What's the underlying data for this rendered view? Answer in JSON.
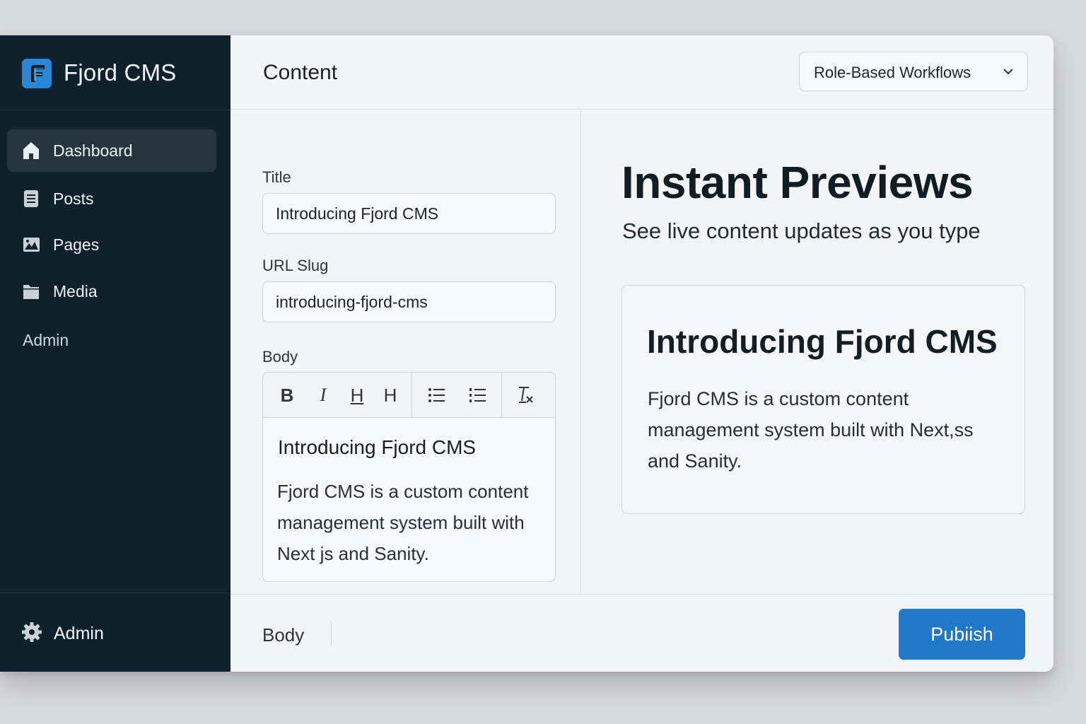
{
  "colors": {
    "sidebar_bg": "#0f212b",
    "accent": "#1f78c9",
    "page_bg": "#f3f4f5"
  },
  "sidebar": {
    "brand": "Fjord CMS",
    "items": [
      {
        "label": "Dashboard",
        "icon": "home-icon",
        "active": true
      },
      {
        "label": "Posts",
        "icon": "document-icon",
        "active": false
      },
      {
        "label": "Pages",
        "icon": "image-icon",
        "active": false
      },
      {
        "label": "Media",
        "icon": "folder-icon",
        "active": false
      }
    ],
    "section_label": "Admin",
    "footer_label": "Admin",
    "footer_icon": "gear-icon"
  },
  "header": {
    "title": "Content",
    "dropdown_value": "Role-Based Workflows"
  },
  "form": {
    "title_label": "Title",
    "title_value": "Introducing Fjord CMS",
    "slug_label": "URL Slug",
    "slug_value": "introducing-fjord-cms",
    "body_label": "Body",
    "toolbar": [
      "B",
      "I",
      "H",
      "H",
      "bulleted-list",
      "numbered-list",
      "clear-format"
    ],
    "editor_heading": "Introducing Fjord CMS",
    "editor_body": "Fjord CMS is a custom content management system built with Next js and Sanity."
  },
  "preview": {
    "title": "Instant Previews",
    "subtitle": "See live content updates as you type",
    "card_title": "Introducing Fjord CMS",
    "card_body": "Fjord CMS is a custom content management system built with Next,ss and Sanity."
  },
  "footer": {
    "label": "Body",
    "publish_label": "Pubiish"
  }
}
